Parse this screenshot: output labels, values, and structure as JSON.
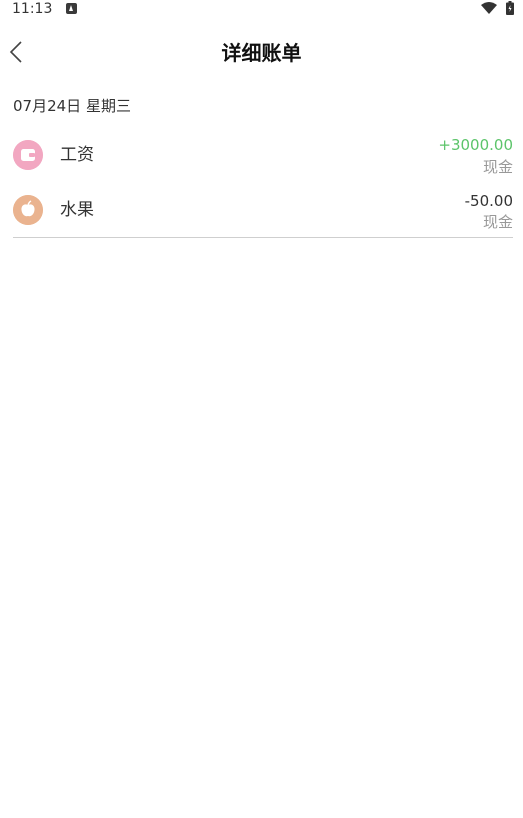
{
  "status_bar": {
    "time": "11:13"
  },
  "header": {
    "title": "详细账单"
  },
  "date_group": {
    "label": "07月24日 星期三"
  },
  "items": [
    {
      "category": "工资",
      "amount": "+3000.00",
      "account": "现金",
      "icon": "wallet-icon",
      "icon_color": "#f2a7c1",
      "amount_color": "#5cc46a"
    },
    {
      "category": "水果",
      "amount": "-50.00",
      "account": "现金",
      "icon": "apple-icon",
      "icon_color": "#eab38f",
      "amount_color": "#333333"
    }
  ]
}
